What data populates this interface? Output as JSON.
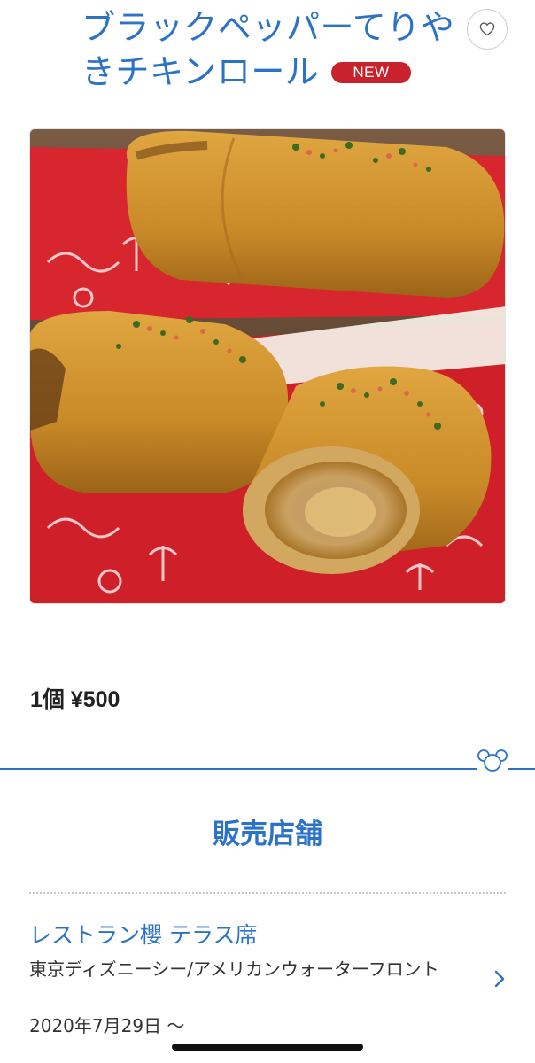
{
  "product": {
    "title": "ブラックペッパーてりやきチキンロール",
    "badge": "NEW",
    "price": "1個 ¥500",
    "favorite_icon": "heart-icon"
  },
  "colors": {
    "accent": "#2c73c8",
    "badge": "#c8232c"
  },
  "section": {
    "title": "販売店舗"
  },
  "store": {
    "name": "レストラン櫻 テラス席",
    "location": "東京ディズニーシー/アメリカンウォーターフロント",
    "date": "2020年7月29日 ～",
    "chevron_icon": "chevron-right-icon"
  }
}
